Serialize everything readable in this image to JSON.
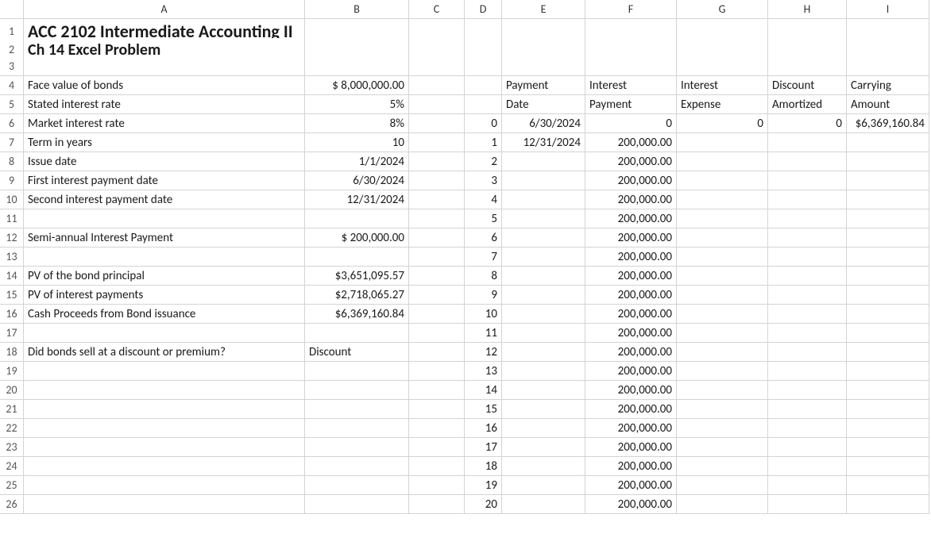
{
  "columns": [
    "A",
    "B",
    "C",
    "D",
    "E",
    "F",
    "G",
    "H",
    "I"
  ],
  "rowCount": 26,
  "title1": "ACC 2102 Intermediate Accounting II",
  "title2": "Ch 14 Excel Problem",
  "labels": {
    "faceValue": "Face value of bonds",
    "statedRate": "Stated interest rate",
    "marketRate": "Market interest rate",
    "termYears": "Term in years",
    "issueDate": "Issue date",
    "firstPayDate": "First interest payment date",
    "secondPayDate": "Second interest payment date",
    "semiAnnualPay": "Semi-annual Interest Payment",
    "pvPrincipal": "PV of the bond principal",
    "pvInterest": "PV of interest payments",
    "cashProceeds": "Cash Proceeds from Bond issuance",
    "discOrPrem": "Did bonds sell at a discount or premium?"
  },
  "values": {
    "faceValue": "$  8,000,000.00",
    "statedRate": "5%",
    "marketRate": "8%",
    "termYears": "10",
    "issueDate": "1/1/2024",
    "firstPayDate": "6/30/2024",
    "secondPayDate": "12/31/2024",
    "semiAnnualPay": "$     200,000.00",
    "pvPrincipal": "$3,651,095.57",
    "pvInterest": "$2,718,065.27",
    "cashProceeds": "$6,369,160.84",
    "discOrPrem": "Discount"
  },
  "amortHeaders": {
    "payment": "Payment",
    "date": "Date",
    "interest": "Interest",
    "paymentWord": "Payment",
    "interest2": "Interest",
    "expense": "Expense",
    "discount": "Discount",
    "amortized": "Amortized",
    "carrying": "Carrying",
    "amount": "Amount"
  },
  "amortRows": [
    {
      "n": "0",
      "date": "6/30/2024",
      "intPay": "0",
      "intExp": "0",
      "discAmort": "0",
      "carry": "$6,369,160.84"
    },
    {
      "n": "1",
      "date": "12/31/2024",
      "intPay": "200,000.00",
      "intExp": "",
      "discAmort": "",
      "carry": ""
    },
    {
      "n": "2",
      "date": "",
      "intPay": "200,000.00",
      "intExp": "",
      "discAmort": "",
      "carry": ""
    },
    {
      "n": "3",
      "date": "",
      "intPay": "200,000.00",
      "intExp": "",
      "discAmort": "",
      "carry": ""
    },
    {
      "n": "4",
      "date": "",
      "intPay": "200,000.00",
      "intExp": "",
      "discAmort": "",
      "carry": ""
    },
    {
      "n": "5",
      "date": "",
      "intPay": "200,000.00",
      "intExp": "",
      "discAmort": "",
      "carry": ""
    },
    {
      "n": "6",
      "date": "",
      "intPay": "200,000.00",
      "intExp": "",
      "discAmort": "",
      "carry": ""
    },
    {
      "n": "7",
      "date": "",
      "intPay": "200,000.00",
      "intExp": "",
      "discAmort": "",
      "carry": ""
    },
    {
      "n": "8",
      "date": "",
      "intPay": "200,000.00",
      "intExp": "",
      "discAmort": "",
      "carry": ""
    },
    {
      "n": "9",
      "date": "",
      "intPay": "200,000.00",
      "intExp": "",
      "discAmort": "",
      "carry": ""
    },
    {
      "n": "10",
      "date": "",
      "intPay": "200,000.00",
      "intExp": "",
      "discAmort": "",
      "carry": ""
    },
    {
      "n": "11",
      "date": "",
      "intPay": "200,000.00",
      "intExp": "",
      "discAmort": "",
      "carry": ""
    },
    {
      "n": "12",
      "date": "",
      "intPay": "200,000.00",
      "intExp": "",
      "discAmort": "",
      "carry": ""
    },
    {
      "n": "13",
      "date": "",
      "intPay": "200,000.00",
      "intExp": "",
      "discAmort": "",
      "carry": ""
    },
    {
      "n": "14",
      "date": "",
      "intPay": "200,000.00",
      "intExp": "",
      "discAmort": "",
      "carry": ""
    },
    {
      "n": "15",
      "date": "",
      "intPay": "200,000.00",
      "intExp": "",
      "discAmort": "",
      "carry": ""
    },
    {
      "n": "16",
      "date": "",
      "intPay": "200,000.00",
      "intExp": "",
      "discAmort": "",
      "carry": ""
    },
    {
      "n": "17",
      "date": "",
      "intPay": "200,000.00",
      "intExp": "",
      "discAmort": "",
      "carry": ""
    },
    {
      "n": "18",
      "date": "",
      "intPay": "200,000.00",
      "intExp": "",
      "discAmort": "",
      "carry": ""
    },
    {
      "n": "19",
      "date": "",
      "intPay": "200,000.00",
      "intExp": "",
      "discAmort": "",
      "carry": ""
    },
    {
      "n": "20",
      "date": "",
      "intPay": "200,000.00",
      "intExp": "",
      "discAmort": "",
      "carry": ""
    }
  ]
}
